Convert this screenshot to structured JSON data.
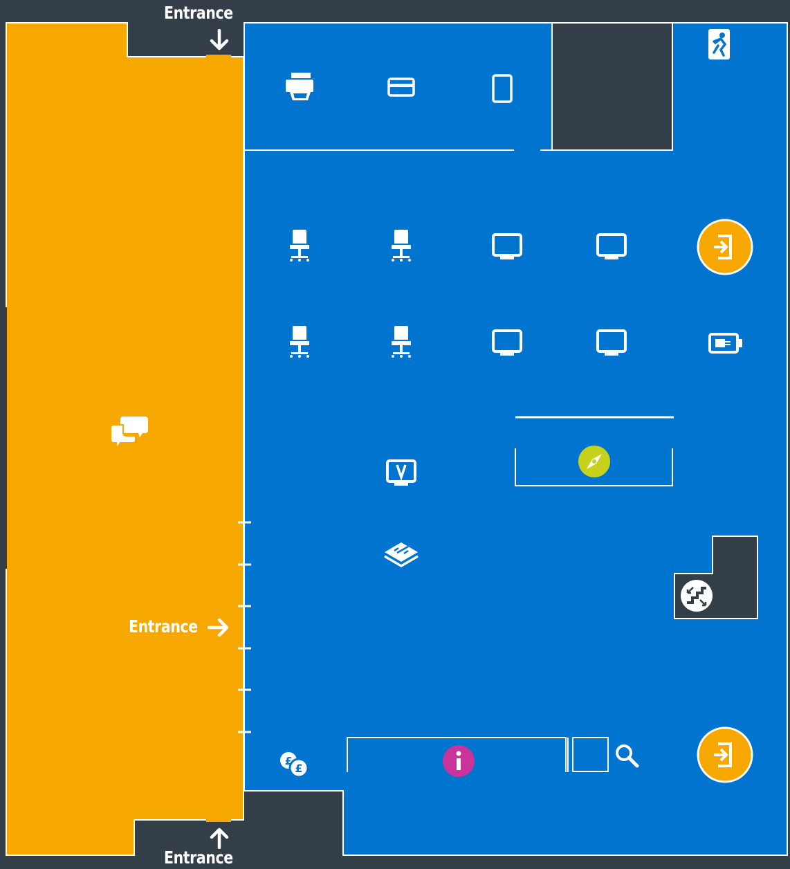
{
  "entrances": {
    "top_label": "Entrance",
    "middle_label": "Entrance",
    "bottom_label": "Entrance"
  },
  "colors": {
    "background": "#333e48",
    "main_floor": "#0074cf",
    "social_zone": "#f6a800",
    "walls": "#ffffff",
    "info_point": "#c8349b",
    "navigation_point": "#c6d21b"
  },
  "icons": [
    "fire-exit-icon",
    "printer-icon",
    "payment-card-icon",
    "tablet-icon",
    "chair-icon",
    "computer-icon",
    "entry-point-icon",
    "charging-point-icon",
    "discussion-icon",
    "video-screen-icon",
    "book-icon",
    "compass-icon",
    "stairs-icon",
    "currency-exchange-icon",
    "information-icon",
    "search-icon"
  ]
}
